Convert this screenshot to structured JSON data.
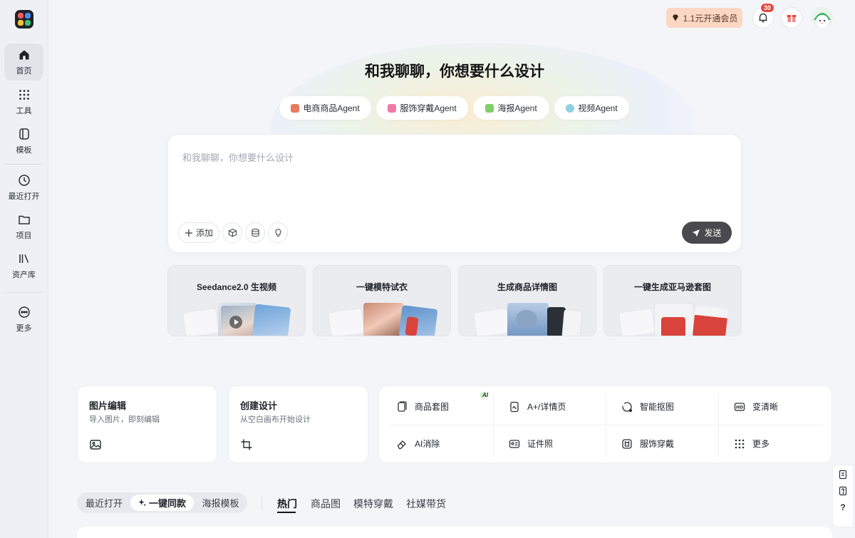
{
  "sidebar": {
    "items": [
      {
        "label": "首页",
        "icon": "home-icon"
      },
      {
        "label": "工具",
        "icon": "grid-dots-icon"
      },
      {
        "label": "模板",
        "icon": "template-icon"
      },
      {
        "label": "最近打开",
        "icon": "clock-icon"
      },
      {
        "label": "项目",
        "icon": "folder-icon"
      },
      {
        "label": "资产库",
        "icon": "library-icon"
      },
      {
        "label": "更多",
        "icon": "more-icon"
      }
    ]
  },
  "topbar": {
    "vip_label": "1.1元开通会员",
    "notification_count": "30"
  },
  "hero": {
    "title": "和我聊聊，你想要什么设计",
    "agents": [
      "电商商品Agent",
      "服饰穿戴Agent",
      "海报Agent",
      "视频Agent"
    ],
    "prompt_placeholder": "和我聊聊，你想要什么设计",
    "add_label": "添加",
    "send_label": "发送"
  },
  "features": [
    {
      "title": "Seedance2.0 生视频"
    },
    {
      "title": "一键模特试衣"
    },
    {
      "title": "生成商品详情图"
    },
    {
      "title": "一键生成亚马逊套图"
    }
  ],
  "quick_cards": [
    {
      "title": "图片编辑",
      "subtitle": "导入图片，即刻编辑"
    },
    {
      "title": "创建设计",
      "subtitle": "从空白画布开始设计"
    }
  ],
  "tools": {
    "ai_tag": "AI",
    "items": [
      "商品套图",
      "A+/详情页",
      "智能抠图",
      "变清晰",
      "AI消除",
      "证件照",
      "服饰穿戴",
      "更多"
    ]
  },
  "tabs": {
    "segments": [
      "最近打开",
      "一键同款",
      "海报模板"
    ],
    "categories": [
      "热门",
      "商品图",
      "模特穿戴",
      "社媒带货"
    ]
  },
  "side_help": {
    "question": "?"
  },
  "colors": {
    "accent": "#1f2329",
    "badge": "#e5483d",
    "vip": "#fbd7c4"
  }
}
